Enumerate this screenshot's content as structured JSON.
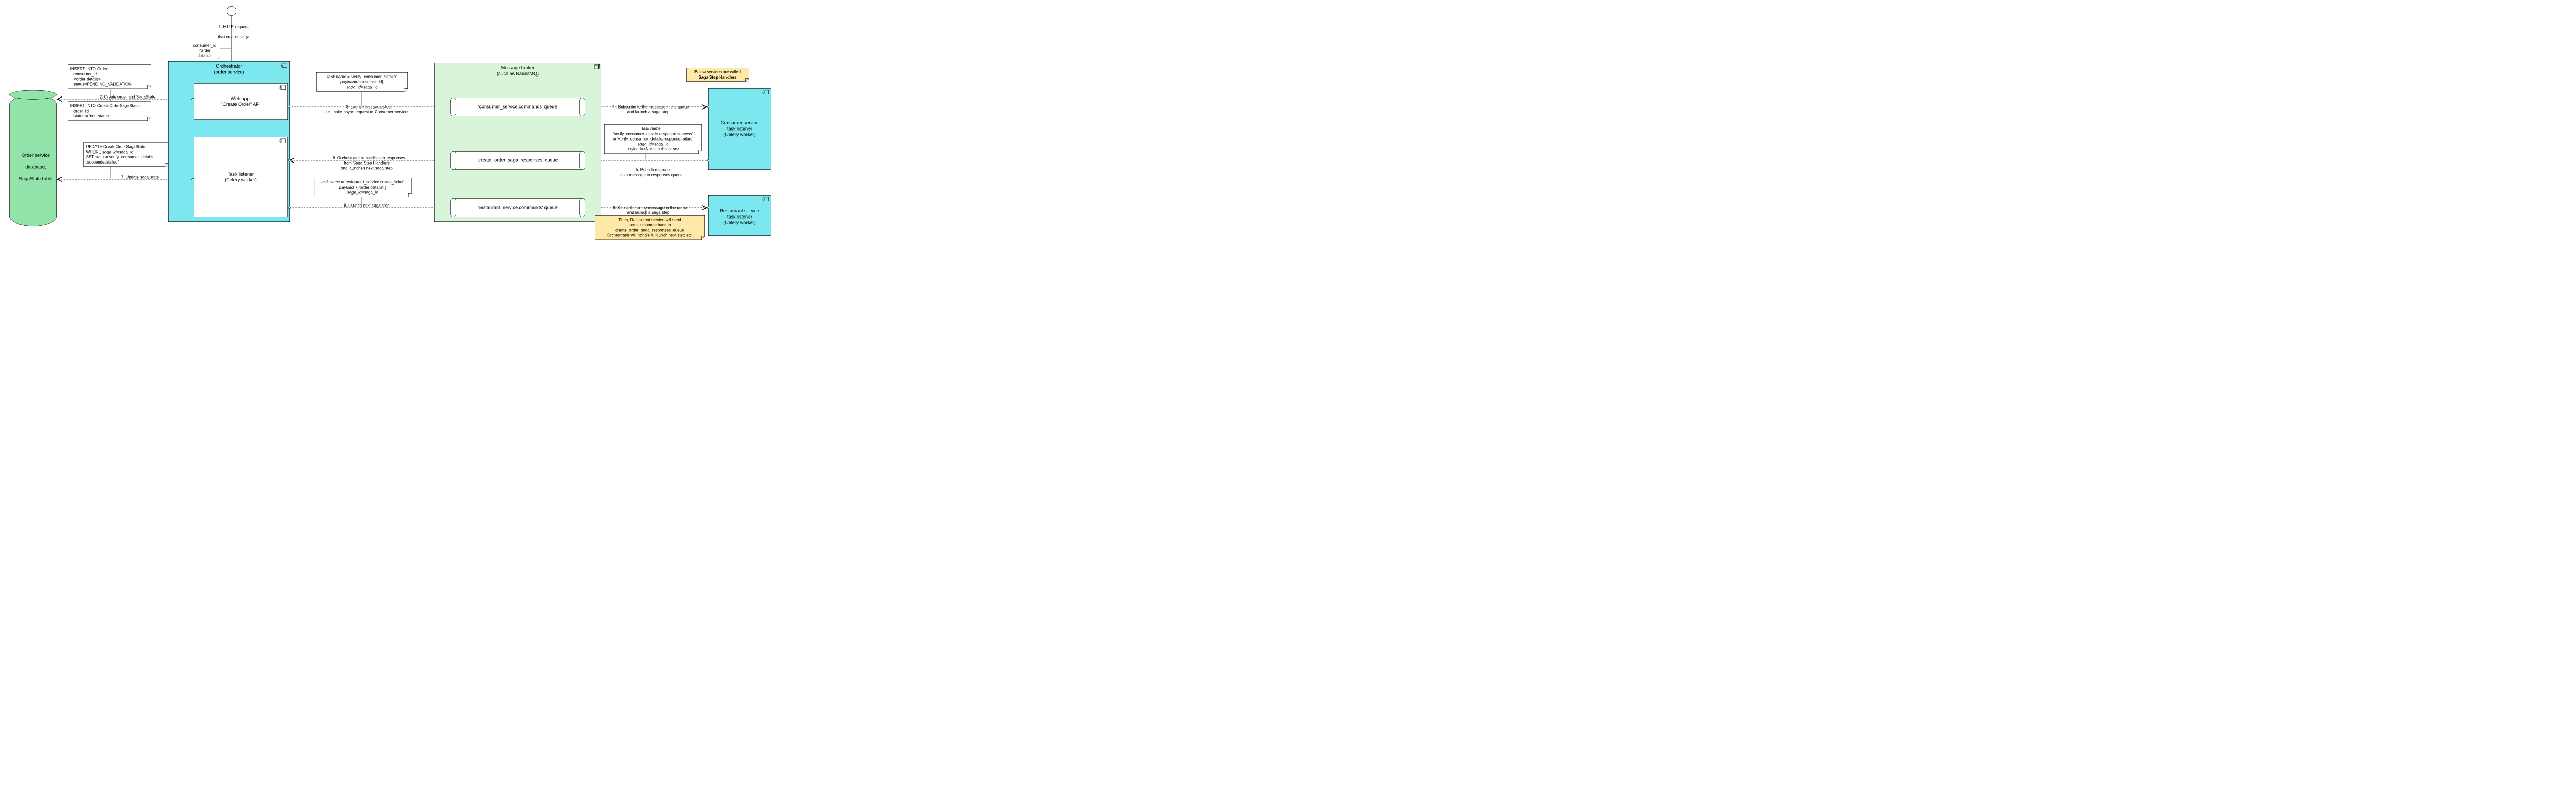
{
  "actor": {
    "label_line1": "1. HTTP request",
    "label_line2": "that creates saga"
  },
  "input_note": {
    "line1": "consumer_id",
    "line2": "<order details>"
  },
  "db": {
    "line1": "Order service",
    "line2": "database,",
    "line3": "SagaState table"
  },
  "orchestrator": {
    "title_line1": "Orchestrator",
    "title_line2": "(order service)",
    "webapp_line1": "Web app.",
    "webapp_line2": "\"Create Order\" API",
    "listener_line1": "Task listener",
    "listener_line2": "(Celery worker)"
  },
  "broker": {
    "title_line1": "Message broker",
    "title_line2": "(such as RabbitMQ)",
    "queue1": "'consumer_service.commands' queue",
    "queue2": "'create_order_saga_responses' queue",
    "queue3": "'restaurant_service.commands' queue"
  },
  "handlers_note": {
    "line1": "Below services are called",
    "line2": "Saga Step Handlers"
  },
  "consumer_svc": {
    "line1": "Consumer service",
    "line2": "task listener",
    "line3": "(Celery worker)"
  },
  "restaurant_svc": {
    "line1": "Restaurant service",
    "line2": "task listener",
    "line3": "(Celery worker)"
  },
  "notes": {
    "insert_order": {
      "l1": "INSERT INTO Order:",
      "l2": "consumer_id",
      "l3": "<order details>",
      "l4": "status=PENDING_VALIDATION"
    },
    "insert_saga": {
      "l1": "INSERT INTO CreateOrderSagaState:",
      "l2": "order_id",
      "l3": "status = 'not_started'"
    },
    "update_saga": {
      "l1": "UPDATE CreateOrderSagaState",
      "l2": "WHERE saga_id=saga_id",
      "l3": "SET status='verify_consumer_details",
      "l4": ".succeeded/failed'"
    },
    "task_verify": {
      "l1": "task name = 'verify_consumer_details'",
      "l2": "payload={consumer_id}",
      "l3": "saga_id=saga_id"
    },
    "task_response": {
      "l1": "task name =",
      "l2": "'verify_consumer_details.response.success'",
      "l3": "or 'verify_consumer_details.response.failure'",
      "l4": "saga_id=saga_id",
      "l5": "payload=<None in this case>"
    },
    "task_ticket": {
      "l1": "task name = 'restaurant_service.create_ticket'",
      "l2": "payload={<order details>}",
      "l3": "saga_id=saga_id"
    },
    "then_note": {
      "l1": "Then, Restaurant service will send",
      "l2": "some response back to",
      "l3": "'create_order_saga_responses' queue,",
      "l4": "Orchestrator will handle it, launch next step etc."
    }
  },
  "edges": {
    "e2": "2. Create order and SagaState",
    "e3_l1": "3. Launch first saga step,",
    "e3_l2": "i.e. make async request to Consumer service",
    "e4_l1": "4 . Subscribe to the message in the queue",
    "e4_l2": "and launch a saga step",
    "e5_l1": "5. Publish response",
    "e5_l2": "as a message to responses queue",
    "e6_l1": "6. Orchestrator subscribes to responses",
    "e6_l2": "from Saga Step Handlers",
    "e6_l3": "and launches next saga step",
    "e7": "7. Update saga state",
    "e8": "8. Launch next saga step",
    "e9_l1": "9. Subscribe to the message in the queue",
    "e9_l2": "and launch a saga step"
  }
}
